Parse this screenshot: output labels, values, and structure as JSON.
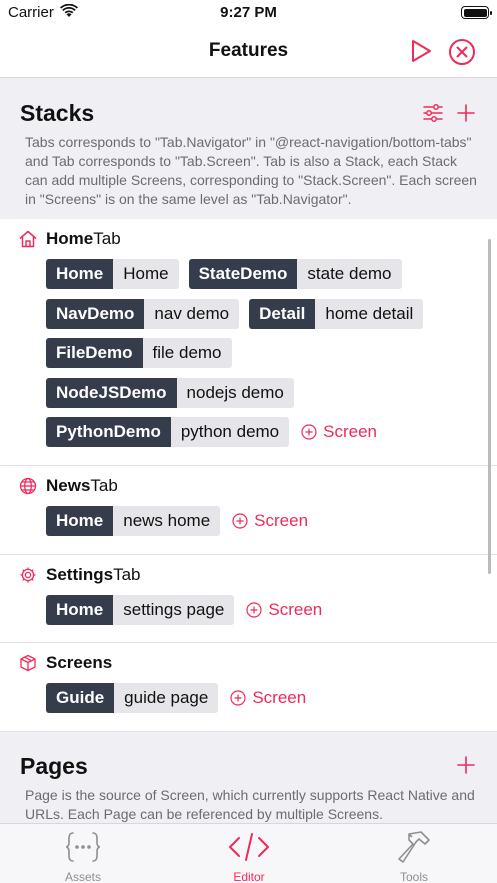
{
  "status": {
    "carrier": "Carrier",
    "time": "9:27 PM"
  },
  "nav": {
    "title": "Features",
    "play_icon": "play-icon",
    "close_icon": "close-circle-icon"
  },
  "colors": {
    "accent": "#ef2b5a",
    "chip_dark": "#353c4c",
    "chip_light": "#e6e6ea"
  },
  "stacks": {
    "title": "Stacks",
    "description": "Tabs corresponds to \"Tab.Navigator\" in \"@react-navigation/bottom-tabs\" and Tab corresponds to \"Tab.Screen\". Tab is also a Stack, each Stack can add multiple Screens, corresponding to \"Stack.Screen\". Each screen in \"Screens\" is on the same level as \"Tab.Navigator\".",
    "tabs": [
      {
        "icon": "home-icon",
        "name": "Home",
        "suffix": "Tab",
        "screens": [
          {
            "key": "Home",
            "value": "Home"
          },
          {
            "key": "StateDemo",
            "value": "state demo"
          },
          {
            "key": "NavDemo",
            "value": "nav demo"
          },
          {
            "key": "Detail",
            "value": "home detail"
          },
          {
            "key": "FileDemo",
            "value": "file demo"
          },
          {
            "key": "NodeJSDemo",
            "value": "nodejs demo"
          },
          {
            "key": "PythonDemo",
            "value": "python demo"
          }
        ],
        "add_label": "Screen"
      },
      {
        "icon": "globe-icon",
        "name": "News",
        "suffix": "Tab",
        "screens": [
          {
            "key": "Home",
            "value": "news home"
          }
        ],
        "add_label": "Screen"
      },
      {
        "icon": "gear-icon",
        "name": "Settings",
        "suffix": "Tab",
        "screens": [
          {
            "key": "Home",
            "value": "settings page"
          }
        ],
        "add_label": "Screen"
      },
      {
        "icon": "cube-icon",
        "name": "Screens",
        "suffix": "",
        "screens": [
          {
            "key": "Guide",
            "value": "guide page"
          }
        ],
        "add_label": "Screen"
      }
    ]
  },
  "pages": {
    "title": "Pages",
    "description": "Page is the source of Screen, which currently supports React Native and URLs. Each Page can be referenced by multiple Screens."
  },
  "tabbar": {
    "items": [
      {
        "label": "Assets",
        "icon": "braces-icon",
        "active": false
      },
      {
        "label": "Editor",
        "icon": "code-icon",
        "active": true
      },
      {
        "label": "Tools",
        "icon": "hammer-icon",
        "active": false
      }
    ]
  }
}
